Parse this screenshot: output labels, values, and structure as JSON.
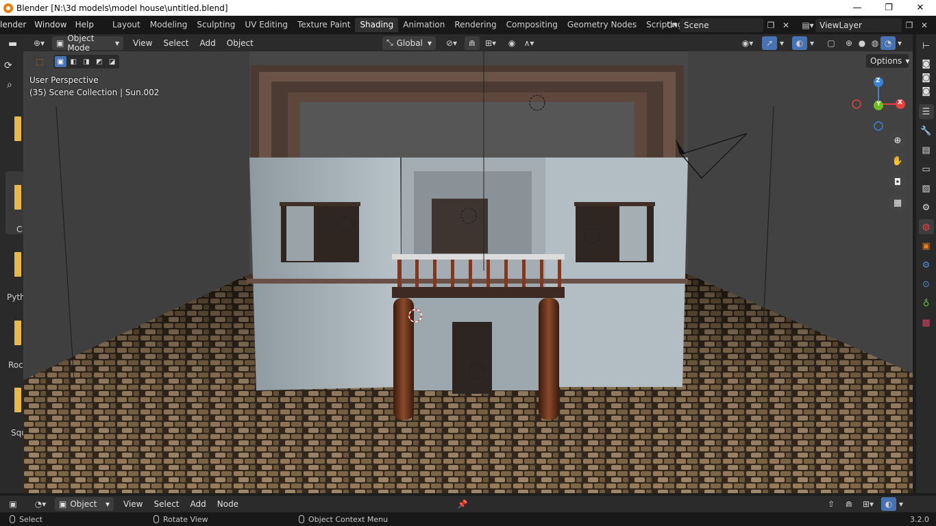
{
  "window": {
    "title": "Blender [N:\\3d models\\model house\\untitled.blend]",
    "controls": [
      "—",
      "❐",
      "✕"
    ]
  },
  "topbar": {
    "menus": [
      "lender",
      "Window",
      "Help"
    ],
    "tabs": [
      "Layout",
      "Modeling",
      "Sculpting",
      "UV Editing",
      "Texture Paint",
      "Shading",
      "Animation",
      "Rendering",
      "Compositing",
      "Geometry Nodes",
      "Scripting"
    ],
    "active_tab": "Shading",
    "scene": "Scene",
    "view_layer": "ViewLayer"
  },
  "viewport_header": {
    "mode": "Object Mode",
    "menus": [
      "View",
      "Select",
      "Add",
      "Object"
    ],
    "transform_orientation": "Global",
    "options_label": "Options"
  },
  "viewport": {
    "perspective": "User Perspective",
    "collection_info": "(35) Scene Collection | Sun.002",
    "gizmo": {
      "z": "Z",
      "x": "X",
      "y": "Y"
    }
  },
  "left_panel": {
    "labels": [
      "C",
      "Pyth",
      "Roc",
      "Squ"
    ]
  },
  "node_header": {
    "object_type": "Object",
    "menus": [
      "View",
      "Select",
      "Add",
      "Node"
    ]
  },
  "statusbar": {
    "select": "Select",
    "rotate": "Rotate View",
    "context": "Object Context Menu",
    "version": "3.2.0"
  },
  "colors": {
    "accent_orange": "#e87d0d",
    "active_blue": "#4772b3",
    "axis_x": "#e8413e",
    "axis_y": "#6dbf1e",
    "axis_z": "#3b83d9"
  }
}
